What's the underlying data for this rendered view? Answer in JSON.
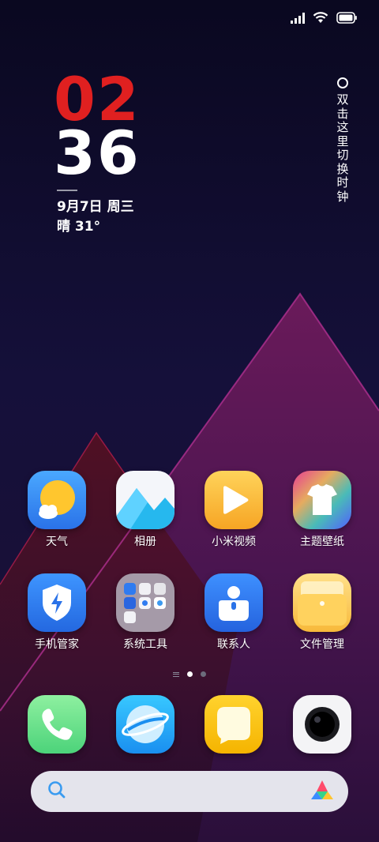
{
  "status_bar": {
    "icons": [
      "signal-icon",
      "wifi-icon",
      "battery-icon"
    ]
  },
  "clock": {
    "hour": "02",
    "minute": "36",
    "date": "9月7日 周三",
    "weather": "晴 31°",
    "hour_color": "#e02020",
    "minute_color": "#ffffff"
  },
  "switch_hint": {
    "text": "双击这里切换时钟"
  },
  "apps": [
    {
      "label": "天气",
      "icon": "weather-icon"
    },
    {
      "label": "相册",
      "icon": "gallery-icon"
    },
    {
      "label": "小米视频",
      "icon": "video-icon"
    },
    {
      "label": "主题壁纸",
      "icon": "themes-icon"
    },
    {
      "label": "手机管家",
      "icon": "security-icon"
    },
    {
      "label": "系统工具",
      "icon": "system-tools-folder-icon"
    },
    {
      "label": "联系人",
      "icon": "contacts-icon"
    },
    {
      "label": "文件管理",
      "icon": "file-manager-icon"
    }
  ],
  "pager": {
    "page_count": 2,
    "active_page": 1
  },
  "dock": [
    {
      "icon": "phone-icon"
    },
    {
      "icon": "browser-icon"
    },
    {
      "icon": "messages-icon"
    },
    {
      "icon": "camera-icon"
    }
  ],
  "search_bar": {
    "left_icon": "search-icon",
    "right_icon": "assistant-icon"
  },
  "colors": {
    "background": "#0d0a26",
    "clock_red": "#e02020",
    "search_bar_bg": "#e4e4ec"
  }
}
